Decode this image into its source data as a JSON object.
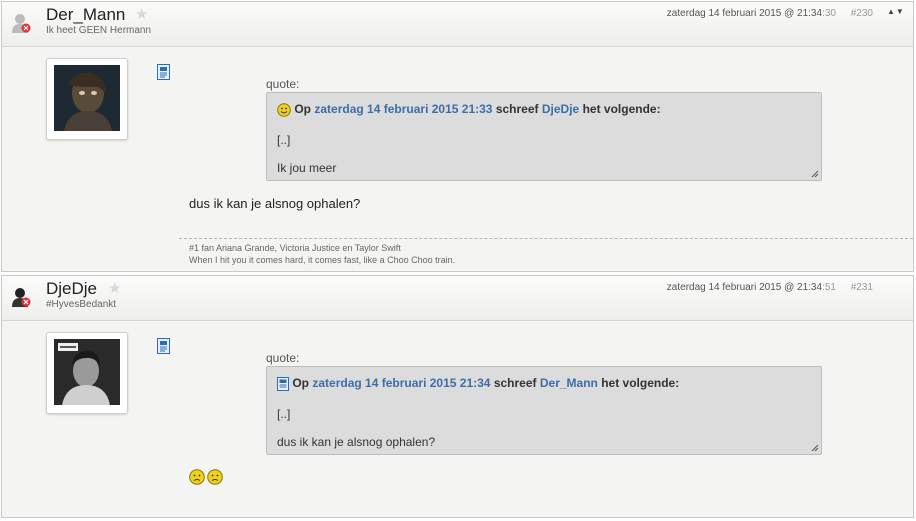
{
  "posts": [
    {
      "username": "Der_Mann",
      "user_title": "Ik heet GEEN Hermann",
      "date_main": "zaterdag 14 februari 2015 @ 21:34",
      "date_seconds": ":30",
      "post_number": "#230",
      "quote_label": "quote:",
      "quote_icon": "smiley-icon",
      "quote_prefix": "Op",
      "quote_date": "zaterdag 14 februari 2015 21:33",
      "quote_mid": "schreef",
      "quote_author": "DjeDje",
      "quote_suffix": "het volgende:",
      "quote_line1": "[..]",
      "quote_line2": "Ik jou meer",
      "body": "dus ik kan je alsnog ophalen?",
      "signature_line1": "#1 fan Ariana Grande, Victoria Justice en Taylor Swift",
      "signature_line2": "When I hit you it comes hard, it comes fast, like a Choo Choo train."
    },
    {
      "username": "DjeDje",
      "user_title": "#HyvesBedankt",
      "date_main": "zaterdag 14 februari 2015 @ 21:34",
      "date_seconds": ":51",
      "post_number": "#231",
      "quote_label": "quote:",
      "quote_icon": "document-icon",
      "quote_prefix": "Op",
      "quote_date": "zaterdag 14 februari 2015 21:34",
      "quote_mid": "schreef",
      "quote_author": "Der_Mann",
      "quote_suffix": "het volgende:",
      "quote_line1": "[..]",
      "quote_line2": "dus ik kan je alsnog ophalen?",
      "body_icons": [
        "sad-smiley-icon",
        "sad-smiley-icon"
      ]
    }
  ],
  "colors": {
    "link": "#3b6ea8",
    "quote_bg": "#dcdcdc",
    "post_bg": "#f4f4f2"
  }
}
